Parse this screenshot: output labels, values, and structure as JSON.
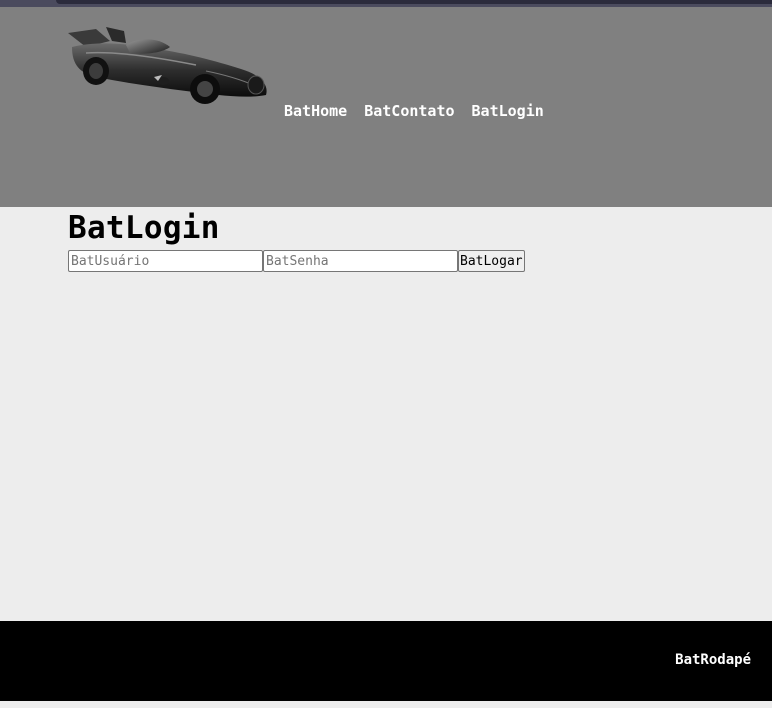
{
  "header": {
    "logo_alt": "Batmobile",
    "nav": [
      {
        "label": "BatHome"
      },
      {
        "label": "BatContato"
      },
      {
        "label": "BatLogin"
      }
    ]
  },
  "main": {
    "title": "BatLogin",
    "form": {
      "username_placeholder": "BatUsuário",
      "username_value": "",
      "password_placeholder": "BatSenha",
      "password_value": "",
      "submit_label": "BatLogar"
    }
  },
  "footer": {
    "text": "BatRodapé"
  },
  "colors": {
    "header_bg": "#808080",
    "main_bg": "#ededed",
    "footer_bg": "#000000",
    "nav_text": "#ffffff"
  },
  "icons": {
    "logo": "batmobile-logo-icon"
  }
}
